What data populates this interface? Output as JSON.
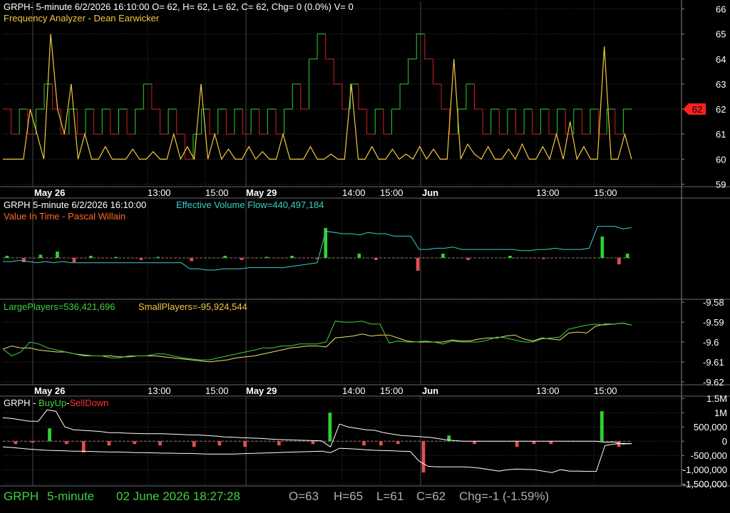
{
  "panel1": {
    "header": "GRPH- 5-minute 6/2/2026 16:10:00 O= 62, H= 62, L= 62, C= 62, Chg= 0 (0.0%) V= 0",
    "indicator": "Frequency Analyzer - Dean Earwicker",
    "price_marker": "62"
  },
  "panel2": {
    "header": "GRPH 5-minute  6/2/2026 16:10:00",
    "evf": "Effective Volume Flow=440,497,184",
    "indicator": "Value In Time - Pascal Willain"
  },
  "panel3": {
    "large": "LargePlayers=536,421,696",
    "small": "SmallPlayers=-95,924,544"
  },
  "panel4": {
    "prefix": "GRPH - ",
    "buy": "BuyUp",
    "sep": "-",
    "sell": "SellDown"
  },
  "status": {
    "symbol": "GRPH",
    "interval": "5-minute",
    "datetime": "02 June 2026 18:27:28",
    "open": "O=63",
    "high": "H=65",
    "low": "L=61",
    "close": "C=62",
    "change": "Chg=-1 (-1.59%)"
  },
  "colors": {
    "background": "#000000",
    "grid": "#3a3a3a",
    "up": "#30d030",
    "down": "#d02020",
    "freq": "#f0c840",
    "evf": "#38d0c8",
    "large": "#40d040",
    "small": "#f0e070",
    "marker": "#ff2020"
  },
  "chart_data": [
    {
      "type": "line",
      "name": "price-panel",
      "x_labels": [
        "May 26",
        "13:00",
        "15:00",
        "May 29",
        "14:00",
        "15:00",
        "Jun",
        "13:00",
        "15:00"
      ],
      "y_ticks": [
        "66",
        "65",
        "64",
        "63",
        "62",
        "61",
        "60",
        "59"
      ],
      "ylim": [
        58.9,
        66.3
      ],
      "price_steps": [
        62,
        61,
        62,
        61,
        62,
        63,
        62,
        61,
        62,
        61,
        62,
        61,
        62,
        61,
        62,
        61,
        62,
        63,
        62,
        61,
        62,
        61,
        60,
        61,
        62,
        61,
        62,
        61,
        62,
        61,
        62,
        61,
        62,
        61,
        62,
        63,
        62,
        64,
        65,
        64,
        63,
        62,
        63,
        62,
        61,
        62,
        61,
        62,
        63,
        64,
        65,
        64,
        63,
        62,
        61,
        62,
        63,
        62,
        61,
        62,
        61,
        62,
        61,
        62,
        61,
        62,
        61,
        62,
        61,
        62,
        61,
        62,
        61,
        62,
        61,
        62
      ],
      "frequency": [
        60,
        60,
        60,
        60,
        62,
        61,
        60,
        65,
        62,
        61,
        63,
        60,
        61,
        60,
        60,
        60.5,
        60,
        60,
        60,
        60.4,
        60,
        60,
        60.3,
        60,
        60,
        61,
        60,
        60.5,
        60,
        63,
        60,
        61,
        60,
        60.4,
        60,
        60,
        60.5,
        60,
        60.3,
        60,
        60,
        61,
        60,
        60,
        60,
        60.5,
        60,
        60,
        60.2,
        60,
        60,
        63,
        60,
        60,
        60.5,
        60,
        60,
        60.4,
        60,
        60.2,
        60,
        60.5,
        60,
        60.4,
        60,
        60,
        64,
        60,
        60.6,
        60.2,
        60,
        60.5,
        60,
        60,
        60.4,
        60,
        60.6,
        60,
        60,
        60.5,
        60,
        61,
        60,
        61.5,
        60,
        60.5,
        60,
        60,
        64.5,
        60,
        60,
        61,
        60
      ]
    },
    {
      "type": "bar",
      "name": "effective-volume-flow",
      "evf_line": [
        -0.15,
        -0.15,
        -0.1,
        -0.15,
        -0.2,
        -0.15,
        -0.2,
        -0.15,
        -0.2,
        -0.2,
        -0.2,
        -0.2,
        -0.2,
        -0.2,
        -0.2,
        -0.2,
        -0.2,
        -0.2,
        -0.2,
        -0.2,
        -0.2,
        -0.2,
        -0.45,
        -0.45,
        -0.5,
        -0.5,
        -0.45,
        -0.45,
        -0.45,
        -0.4,
        -0.4,
        -0.4,
        -0.4,
        -0.4,
        -0.35,
        -0.3,
        -0.25,
        -0.2,
        1.1,
        1.05,
        1.0,
        1.0,
        0.95,
        1.05,
        1.0,
        1.0,
        0.9,
        0.9,
        0.9,
        0.35,
        0.35,
        0.4,
        0.4,
        0.45,
        0.35,
        0.35,
        0.35,
        0.35,
        0.35,
        0.35,
        0.35,
        0.3,
        0.3,
        0.35,
        0.35,
        0.4,
        0.35,
        0.35,
        0.35,
        0.4,
        1.3,
        1.3,
        1.3,
        1.2,
        1.25
      ],
      "bars": [
        0.1,
        0,
        -0.2,
        0,
        0.15,
        0,
        0.3,
        0,
        -0.2,
        0,
        0.1,
        0,
        0,
        0.05,
        0,
        0,
        -0.1,
        0,
        0.05,
        0,
        0,
        0,
        -0.15,
        0,
        0,
        0,
        0.1,
        0,
        -0.1,
        0,
        0,
        0.05,
        0,
        0,
        0.1,
        0,
        0,
        -0.05,
        1.4,
        0,
        0,
        0,
        0.2,
        0,
        -0.1,
        0,
        0,
        0,
        0,
        -0.6,
        0,
        0,
        0.2,
        0,
        0,
        -0.1,
        0,
        0,
        0,
        0,
        0.1,
        0,
        0,
        0,
        -0.05,
        0,
        0,
        0,
        0,
        0,
        0,
        1.0,
        0,
        -0.3,
        0.2
      ]
    },
    {
      "type": "line",
      "name": "players-panel",
      "y_ticks": [
        "-9.58",
        "-9.59",
        "-9.6",
        "-9.61",
        "-9.62"
      ],
      "ylim": [
        -9.6215,
        -9.5785
      ],
      "large": [
        -9.6035,
        -9.607,
        -9.605,
        -9.6,
        -9.601,
        -9.603,
        -9.604,
        -9.605,
        -9.606,
        -9.607,
        -9.607,
        -9.607,
        -9.608,
        -9.608,
        -9.607,
        -9.607,
        -9.607,
        -9.606,
        -9.606,
        -9.607,
        -9.608,
        -9.6085,
        -9.609,
        -9.609,
        -9.608,
        -9.607,
        -9.606,
        -9.605,
        -9.604,
        -9.603,
        -9.603,
        -9.602,
        -9.602,
        -9.601,
        -9.601,
        -9.601,
        -9.6,
        -9.5895,
        -9.59,
        -9.59,
        -9.5895,
        -9.591,
        -9.591,
        -9.6005,
        -9.5995,
        -9.6,
        -9.6,
        -9.5995,
        -9.6,
        -9.601,
        -9.5995,
        -9.6,
        -9.6,
        -9.6,
        -9.599,
        -9.5975,
        -9.598,
        -9.599,
        -9.6,
        -9.6,
        -9.5985,
        -9.598,
        -9.5975,
        -9.5935,
        -9.5925,
        -9.5915,
        -9.591,
        -9.5915,
        -9.591,
        -9.5905,
        -9.5915
      ],
      "small": [
        -9.6035,
        -9.602,
        -9.603,
        -9.603,
        -9.604,
        -9.6045,
        -9.605,
        -9.605,
        -9.606,
        -9.6065,
        -9.607,
        -9.607,
        -9.607,
        -9.6075,
        -9.6075,
        -9.607,
        -9.607,
        -9.607,
        -9.6075,
        -9.608,
        -9.6085,
        -9.609,
        -9.6095,
        -9.61,
        -9.6095,
        -9.609,
        -9.608,
        -9.6075,
        -9.607,
        -9.606,
        -9.605,
        -9.604,
        -9.603,
        -9.6025,
        -9.602,
        -9.602,
        -9.6025,
        -9.598,
        -9.5975,
        -9.597,
        -9.596,
        -9.597,
        -9.5965,
        -9.5965,
        -9.598,
        -9.5995,
        -9.6,
        -9.6,
        -9.6,
        -9.6,
        -9.599,
        -9.5995,
        -9.5995,
        -9.5985,
        -9.598,
        -9.598,
        -9.597,
        -9.5965,
        -9.5985,
        -9.5995,
        -9.598,
        -9.5985,
        -9.599,
        -9.5955,
        -9.595,
        -9.5955,
        -9.592,
        -9.591,
        -9.591,
        -9.5905,
        -9.5915
      ]
    },
    {
      "type": "bar",
      "name": "buyup-selldown",
      "y_ticks": [
        "1.5M",
        "1M",
        "500,000",
        "0",
        "-500,000",
        "-1,000,000",
        "-1,500,000"
      ],
      "ylim": [
        -1570000,
        1580000
      ],
      "x_labels": [
        "May 26",
        "13:00",
        "15:00",
        "May 29",
        "14:00",
        "15:00",
        "Jun",
        "13:00",
        "15:00"
      ],
      "upper_line": [
        820000,
        800000,
        750000,
        700000,
        700000,
        1100000,
        1050000,
        500000,
        400000,
        380000,
        360000,
        340000,
        300000,
        300000,
        280000,
        270000,
        260000,
        260000,
        260000,
        250000,
        240000,
        220000,
        220000,
        200000,
        180000,
        150000,
        140000,
        120000,
        110000,
        100000,
        80000,
        60000,
        50000,
        40000,
        30000,
        20000,
        10000,
        -200000,
        600000,
        500000,
        450000,
        400000,
        380000,
        300000,
        250000,
        200000,
        180000,
        160000,
        140000,
        100000,
        50000,
        20000,
        0,
        0,
        0,
        0,
        0,
        0,
        0,
        0,
        0,
        0,
        0,
        0,
        0,
        0,
        0,
        0,
        -40000,
        -30000,
        -100000,
        -80000
      ],
      "lower_line": [
        -200000,
        -220000,
        -250000,
        -280000,
        -300000,
        -320000,
        -330000,
        -340000,
        -350000,
        -350000,
        -360000,
        -370000,
        -380000,
        -380000,
        -390000,
        -400000,
        -400000,
        -410000,
        -420000,
        -420000,
        -430000,
        -430000,
        -440000,
        -450000,
        -450000,
        -450000,
        -450000,
        -440000,
        -430000,
        -420000,
        -410000,
        -400000,
        -390000,
        -380000,
        -370000,
        -360000,
        -350000,
        -400000,
        -250000,
        -260000,
        -280000,
        -300000,
        -320000,
        -330000,
        -340000,
        -350000,
        -360000,
        -700000,
        -880000,
        -900000,
        -900000,
        -900000,
        -900000,
        -920000,
        -950000,
        -1000000,
        -1050000,
        -1000000,
        -980000,
        -990000,
        -1000000,
        -1050000,
        -1100000,
        -1000000,
        -1050000,
        -1050000,
        -1060000,
        -1060000,
        -150000,
        -100000,
        -80000,
        -90000
      ],
      "bars": [
        0,
        -100000,
        0,
        -50000,
        0,
        450000,
        0,
        -100000,
        0,
        -400000,
        0,
        0,
        -150000,
        0,
        0,
        -100000,
        0,
        0,
        -150000,
        0,
        0,
        0,
        -200000,
        0,
        0,
        -150000,
        0,
        0,
        -200000,
        0,
        0,
        0,
        -150000,
        0,
        0,
        0,
        -100000,
        0,
        1000000,
        0,
        0,
        0,
        -150000,
        0,
        -150000,
        0,
        -100000,
        0,
        0,
        -1100000,
        0,
        0,
        200000,
        0,
        0,
        -100000,
        0,
        0,
        0,
        0,
        -200000,
        0,
        -100000,
        0,
        -100000,
        0,
        0,
        0,
        0,
        0,
        1050000,
        0,
        -200000,
        0
      ]
    }
  ]
}
